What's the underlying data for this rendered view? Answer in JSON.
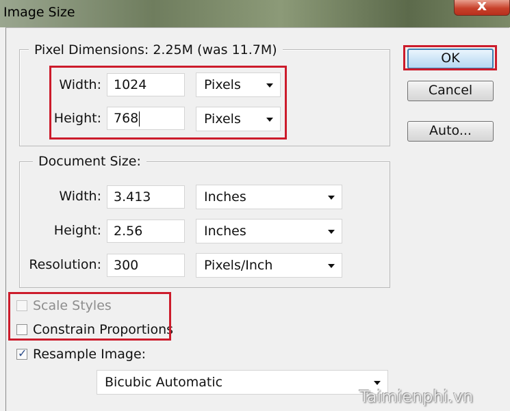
{
  "window": {
    "title": "Image Size",
    "close_glyph": "x"
  },
  "pixel_dimensions": {
    "legend": "Pixel Dimensions:  2.25M (was 11.7M)",
    "width": {
      "label": "Width:",
      "value": "1024",
      "unit": "Pixels"
    },
    "height": {
      "label": "Height:",
      "value": "768",
      "unit": "Pixels"
    }
  },
  "document_size": {
    "legend": "Document Size:",
    "width": {
      "label": "Width:",
      "value": "3.413",
      "unit": "Inches"
    },
    "height": {
      "label": "Height:",
      "value": "2.56",
      "unit": "Inches"
    },
    "resolution": {
      "label": "Resolution:",
      "value": "300",
      "unit": "Pixels/Inch"
    }
  },
  "buttons": {
    "ok": "OK",
    "cancel": "Cancel",
    "auto": "Auto..."
  },
  "options": {
    "scale_styles": {
      "label": "Scale Styles",
      "checked": false,
      "enabled": false
    },
    "constrain_proportions": {
      "label": "Constrain Proportions",
      "checked": false,
      "enabled": true
    },
    "resample_image": {
      "label": "Resample Image:",
      "checked": true,
      "enabled": true
    }
  },
  "resample_method": "Bicubic Automatic",
  "watermark": "Taimienphi.vn",
  "colors": {
    "highlight": "#cc1b2b",
    "default_button_border": "#3c7fb1"
  }
}
